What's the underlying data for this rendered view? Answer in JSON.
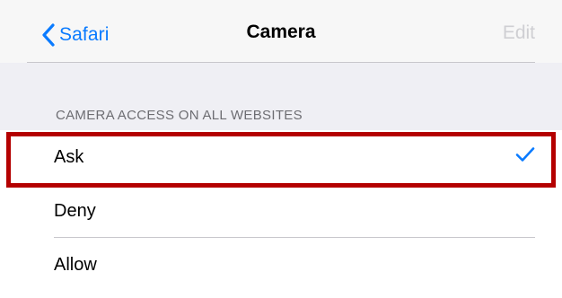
{
  "navbar": {
    "back_label": "Safari",
    "title": "Camera",
    "edit_label": "Edit"
  },
  "section": {
    "header": "CAMERA ACCESS ON ALL WEBSITES"
  },
  "options": [
    {
      "label": "Ask",
      "selected": true
    },
    {
      "label": "Deny",
      "selected": false
    },
    {
      "label": "Allow",
      "selected": false
    }
  ],
  "colors": {
    "accent": "#0a7bff",
    "highlight": "#b40000",
    "disabled_text": "#cfcfd3"
  },
  "icons": {
    "back": "chevron-left-icon",
    "selected": "checkmark-icon"
  }
}
